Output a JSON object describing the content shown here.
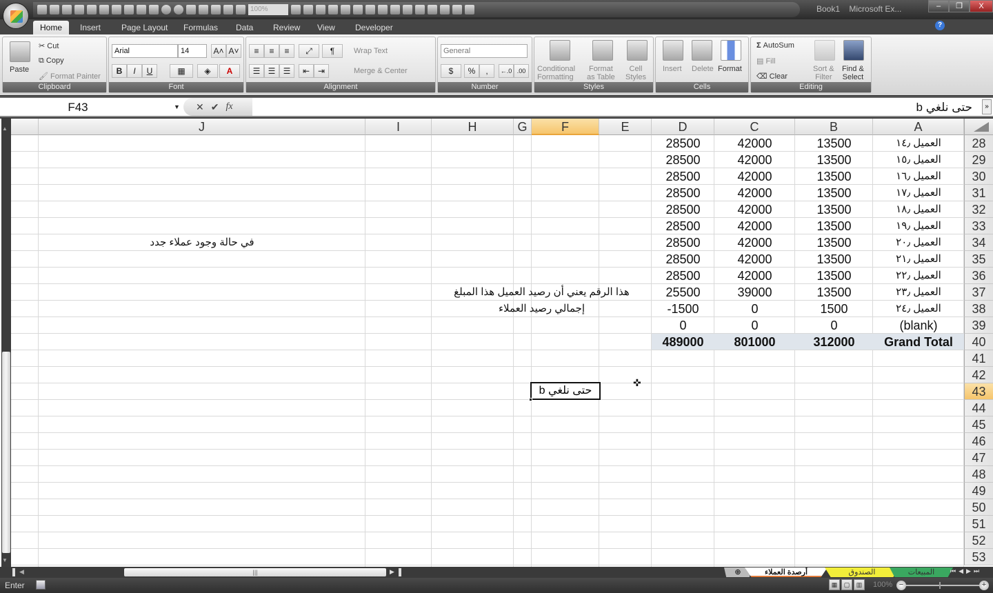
{
  "window": {
    "title_book": "Book1",
    "title_app": "Microsoft Ex...",
    "minimize": "–",
    "restore": "❐",
    "close": "X",
    "qat_zoom": "100%"
  },
  "tabs": [
    "Home",
    "Insert",
    "Page Layout",
    "Formulas",
    "Data",
    "Review",
    "View",
    "Developer"
  ],
  "active_tab": "Home",
  "help_icon": "?",
  "ribbon": {
    "clipboard": {
      "label": "Clipboard",
      "paste": "Paste",
      "cut": "Cut",
      "copy": "Copy",
      "format_painter": "Format Painter"
    },
    "font": {
      "label": "Font",
      "name": "Arial",
      "size": "14",
      "grow": "A˄",
      "shrink": "A˅",
      "bold": "B",
      "italic": "I",
      "underline": "U",
      "font_color": "A"
    },
    "alignment": {
      "label": "Alignment",
      "wrap_text": "Wrap Text",
      "merge_center": "Merge & Center"
    },
    "number": {
      "label": "Number",
      "format": "General",
      "percent": "%",
      "comma": ",",
      "inc_dec": "←.0",
      "dec_dec": ".00"
    },
    "styles": {
      "label": "Styles",
      "conditional_1": "Conditional",
      "conditional_2": "Formatting",
      "format_table_1": "Format",
      "format_table_2": "as Table",
      "cell_styles_1": "Cell",
      "cell_styles_2": "Styles"
    },
    "cells": {
      "label": "Cells",
      "insert": "Insert",
      "delete": "Delete",
      "format": "Format"
    },
    "editing": {
      "label": "Editing",
      "autosum": "AutoSum",
      "fill": "Fill",
      "clear": "Clear",
      "sort_1": "Sort &",
      "sort_2": "Filter",
      "find_1": "Find &",
      "find_2": "Select"
    }
  },
  "formula_bar": {
    "name_box": "F43",
    "cancel": "✕",
    "enter": "✔",
    "fx": "fx",
    "content": "حتى نلغي b"
  },
  "columns": [
    "J",
    "I",
    "H",
    "G",
    "F",
    "E",
    "D",
    "C",
    "B",
    "A"
  ],
  "selected_column": "F",
  "rows": [
    "28",
    "29",
    "30",
    "31",
    "32",
    "33",
    "34",
    "35",
    "36",
    "37",
    "38",
    "39",
    "40",
    "41",
    "42",
    "43",
    "44",
    "45",
    "46",
    "47",
    "48",
    "49",
    "50",
    "51",
    "52",
    "53"
  ],
  "selected_row": "43",
  "table": [
    {
      "row": "28",
      "A": "العميل ١٤٫",
      "B": "13500",
      "C": "42000",
      "D": "28500"
    },
    {
      "row": "29",
      "A": "العميل ١٥٫",
      "B": "13500",
      "C": "42000",
      "D": "28500"
    },
    {
      "row": "30",
      "A": "العميل ١٦٫",
      "B": "13500",
      "C": "42000",
      "D": "28500"
    },
    {
      "row": "31",
      "A": "العميل ١٧٫",
      "B": "13500",
      "C": "42000",
      "D": "28500"
    },
    {
      "row": "32",
      "A": "العميل ١٨٫",
      "B": "13500",
      "C": "42000",
      "D": "28500"
    },
    {
      "row": "33",
      "A": "العميل ١٩٫",
      "B": "13500",
      "C": "42000",
      "D": "28500"
    },
    {
      "row": "34",
      "A": "العميل ٢٠٫",
      "B": "13500",
      "C": "42000",
      "D": "28500"
    },
    {
      "row": "35",
      "A": "العميل ٢١٫",
      "B": "13500",
      "C": "42000",
      "D": "28500"
    },
    {
      "row": "36",
      "A": "العميل ٢٢٫",
      "B": "13500",
      "C": "42000",
      "D": "28500"
    },
    {
      "row": "37",
      "A": "العميل ٢٣٫",
      "B": "13500",
      "C": "39000",
      "D": "25500"
    },
    {
      "row": "38",
      "A": "العميل ٢٤٫",
      "B": "1500",
      "C": "0",
      "D": "-1500"
    },
    {
      "row": "39",
      "A": "(blank)",
      "B": "0",
      "C": "0",
      "D": "0"
    },
    {
      "row": "40",
      "A": "Grand Total",
      "B": "312000",
      "C": "801000",
      "D": "489000"
    }
  ],
  "notes": {
    "new_clients": "في حالة وجود عملاء جدد",
    "balance_meaning": "هذا الرقم يعني أن رصيد العميل هذا المبلغ",
    "total_balance": "إجمالي رصيد العملاء",
    "active_cell": "حتى نلغي b"
  },
  "sheets": [
    {
      "name": "أرصدة العملاء",
      "color": "#e07a3a",
      "active": true
    },
    {
      "name": "الصندوق",
      "color": "#f2ee3a",
      "active": false
    },
    {
      "name": "المبيعات",
      "color": "#3aa860",
      "active": false
    }
  ],
  "status": {
    "mode": "Enter",
    "zoom": "100%"
  },
  "colors": {
    "selected_header": "#f6c56c",
    "grand_total_bg": "#dfe5ec"
  }
}
